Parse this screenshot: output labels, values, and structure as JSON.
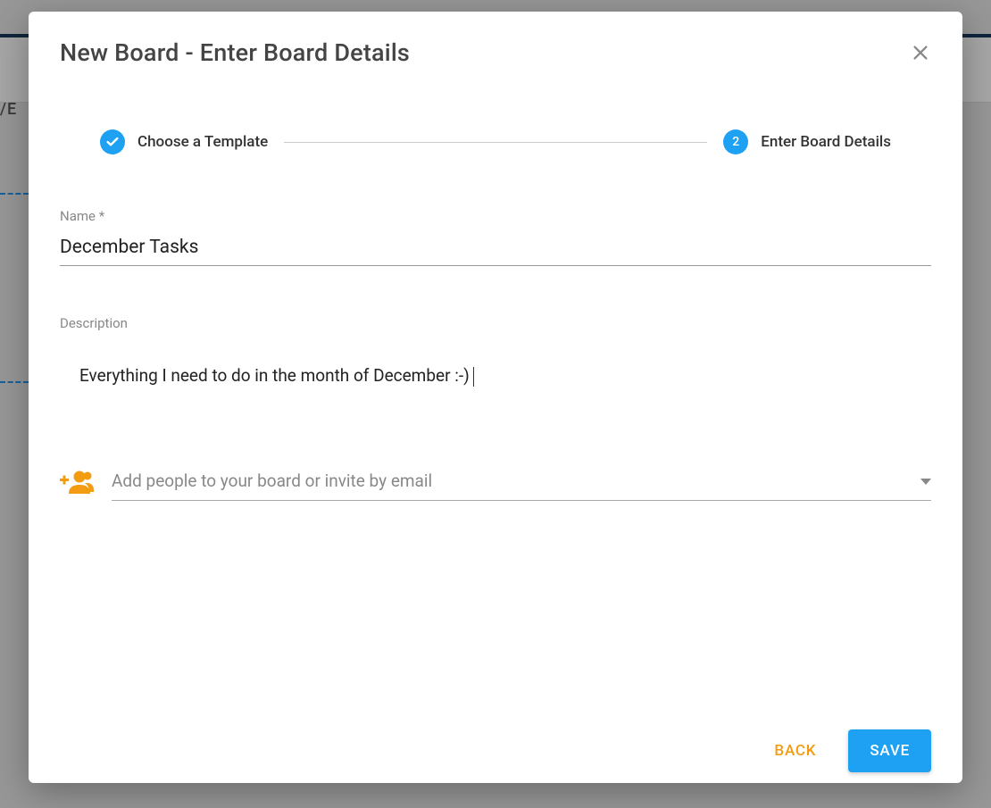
{
  "background": {
    "nav_text": "/E"
  },
  "modal": {
    "title": "New Board - Enter Board Details",
    "stepper": {
      "step1_label": "Choose a Template",
      "step2_number": "2",
      "step2_label": "Enter Board Details"
    },
    "form": {
      "name_label": "Name *",
      "name_value": "December Tasks",
      "description_label": "Description",
      "description_value": "Everything I need to do in the month of December :-)",
      "people_placeholder": "Add people to your board or invite by email"
    },
    "footer": {
      "back_label": "BACK",
      "save_label": "SAVE"
    }
  }
}
